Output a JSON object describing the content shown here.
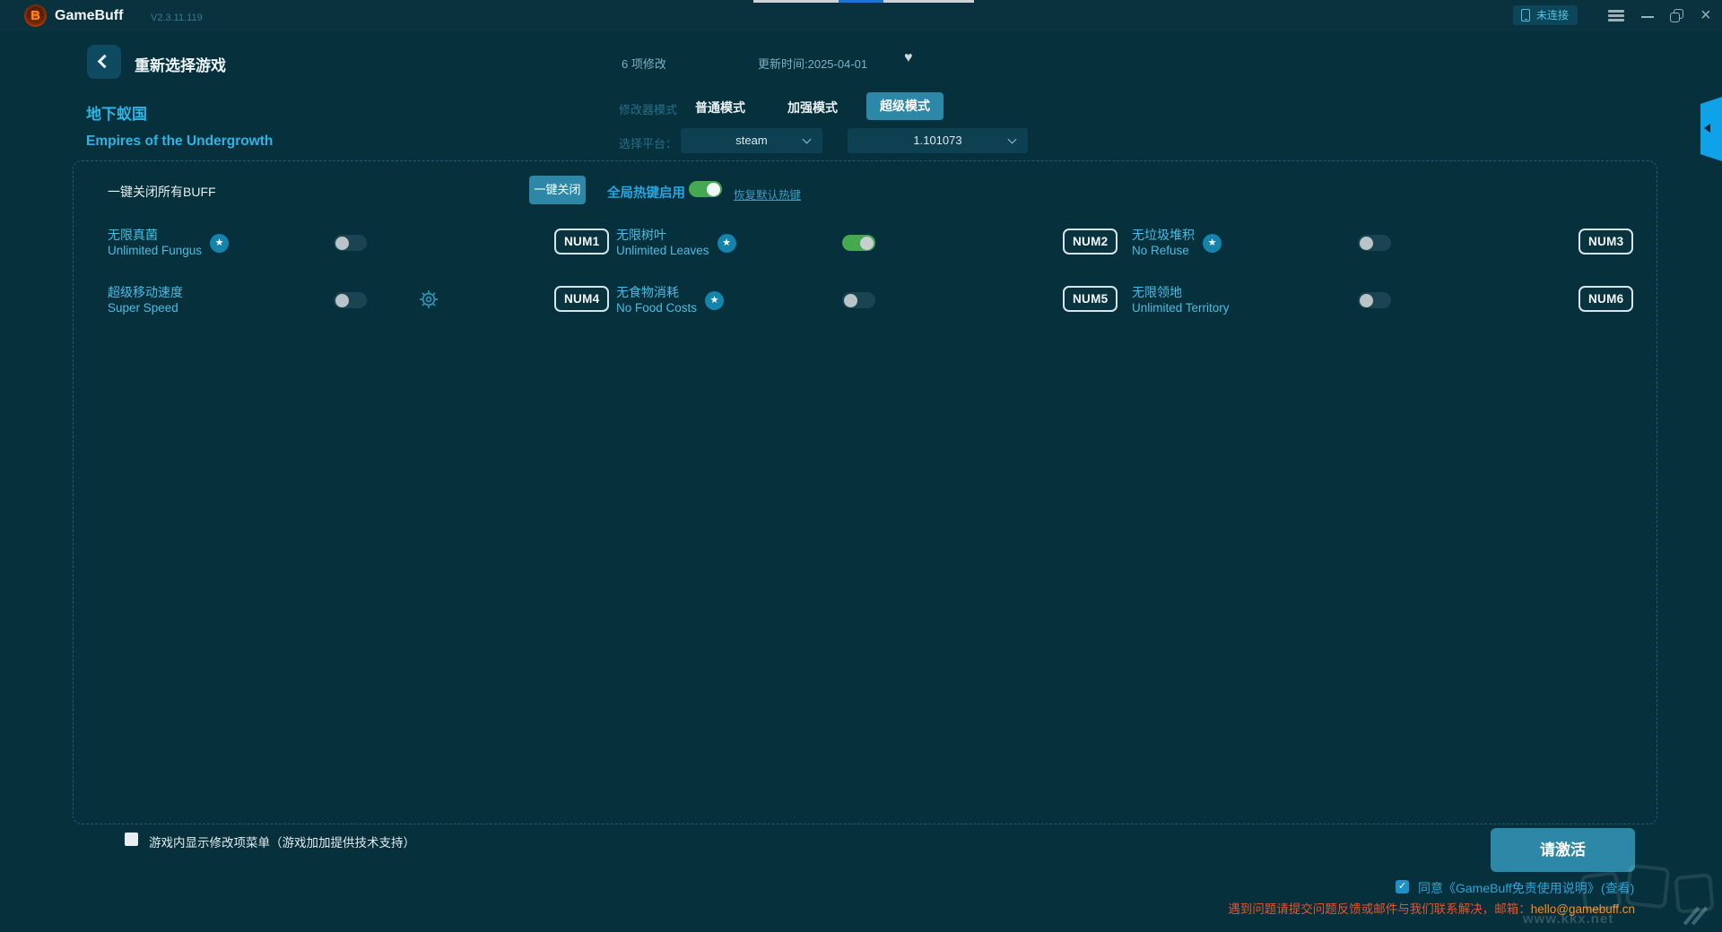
{
  "window": {
    "app_name": "GameBuff",
    "version": "V2.3.11.119",
    "connection_status": "未连接"
  },
  "icons": {
    "star": "★",
    "heart": "♥",
    "check": "✓",
    "close": "×",
    "logo_letter": "B"
  },
  "header": {
    "title": "重新选择游戏",
    "mods_count": "6 项修改",
    "update_time": "更新时间:2025-04-01"
  },
  "game": {
    "title_zh": "地下蚁国",
    "title_en": "Empires of the Undergrowth"
  },
  "modes": {
    "label": "修改器模式",
    "options": [
      "普通模式",
      "加强模式",
      "超级模式"
    ],
    "selected": "超级模式"
  },
  "platform": {
    "label": "选择平台：",
    "value": "steam",
    "game_version": "1.101073"
  },
  "panel": {
    "close_all_label": "一键关闭所有BUFF",
    "close_all_button": "一键关闭",
    "global_hotkey_label": "全局热键启用",
    "global_hotkey_enabled": true,
    "restore_hotkeys_link": "恢复默认热键"
  },
  "cheats": [
    {
      "zh": "无限真菌",
      "en": "Unlimited Fungus",
      "hotkey": "NUM1",
      "enabled": false,
      "star": true,
      "gear": false
    },
    {
      "zh": "无限树叶",
      "en": "Unlimited Leaves",
      "hotkey": "NUM2",
      "enabled": true,
      "star": true,
      "gear": false
    },
    {
      "zh": "无垃圾堆积",
      "en": "No Refuse",
      "hotkey": "NUM3",
      "enabled": false,
      "star": true,
      "gear": false
    },
    {
      "zh": "超级移动速度",
      "en": "Super Speed",
      "hotkey": "NUM4",
      "enabled": false,
      "star": false,
      "gear": true
    },
    {
      "zh": "无食物消耗",
      "en": "No Food Costs",
      "hotkey": "NUM5",
      "enabled": false,
      "star": true,
      "gear": false
    },
    {
      "zh": "无限领地",
      "en": "Unlimited Territory",
      "hotkey": "NUM6",
      "enabled": false,
      "star": false,
      "gear": false
    }
  ],
  "footer": {
    "ingame_menu_label": "游戏内显示修改项菜单（游戏加加提供技术支持）",
    "ingame_menu_checked": false,
    "activate_button": "请激活",
    "agree_checked": true,
    "agree_label": "同意《GameBuff免责使用说明》",
    "view_link": "(查看)",
    "support_text": "遇到问题请提交问题反馈或邮件与我们联系解决，邮箱：",
    "support_email": "hello@gamebuff.cn",
    "watermark": "www.kkx.net"
  },
  "colors": {
    "accent_teal_button": "#2d87a6",
    "accent_cyan_text": "#2cb4e4",
    "toggle_on_green": "#45a94f",
    "support_orange": "#e5552b",
    "email_orange": "#ff8a1c",
    "side_tab_blue": "#10a2e8"
  }
}
